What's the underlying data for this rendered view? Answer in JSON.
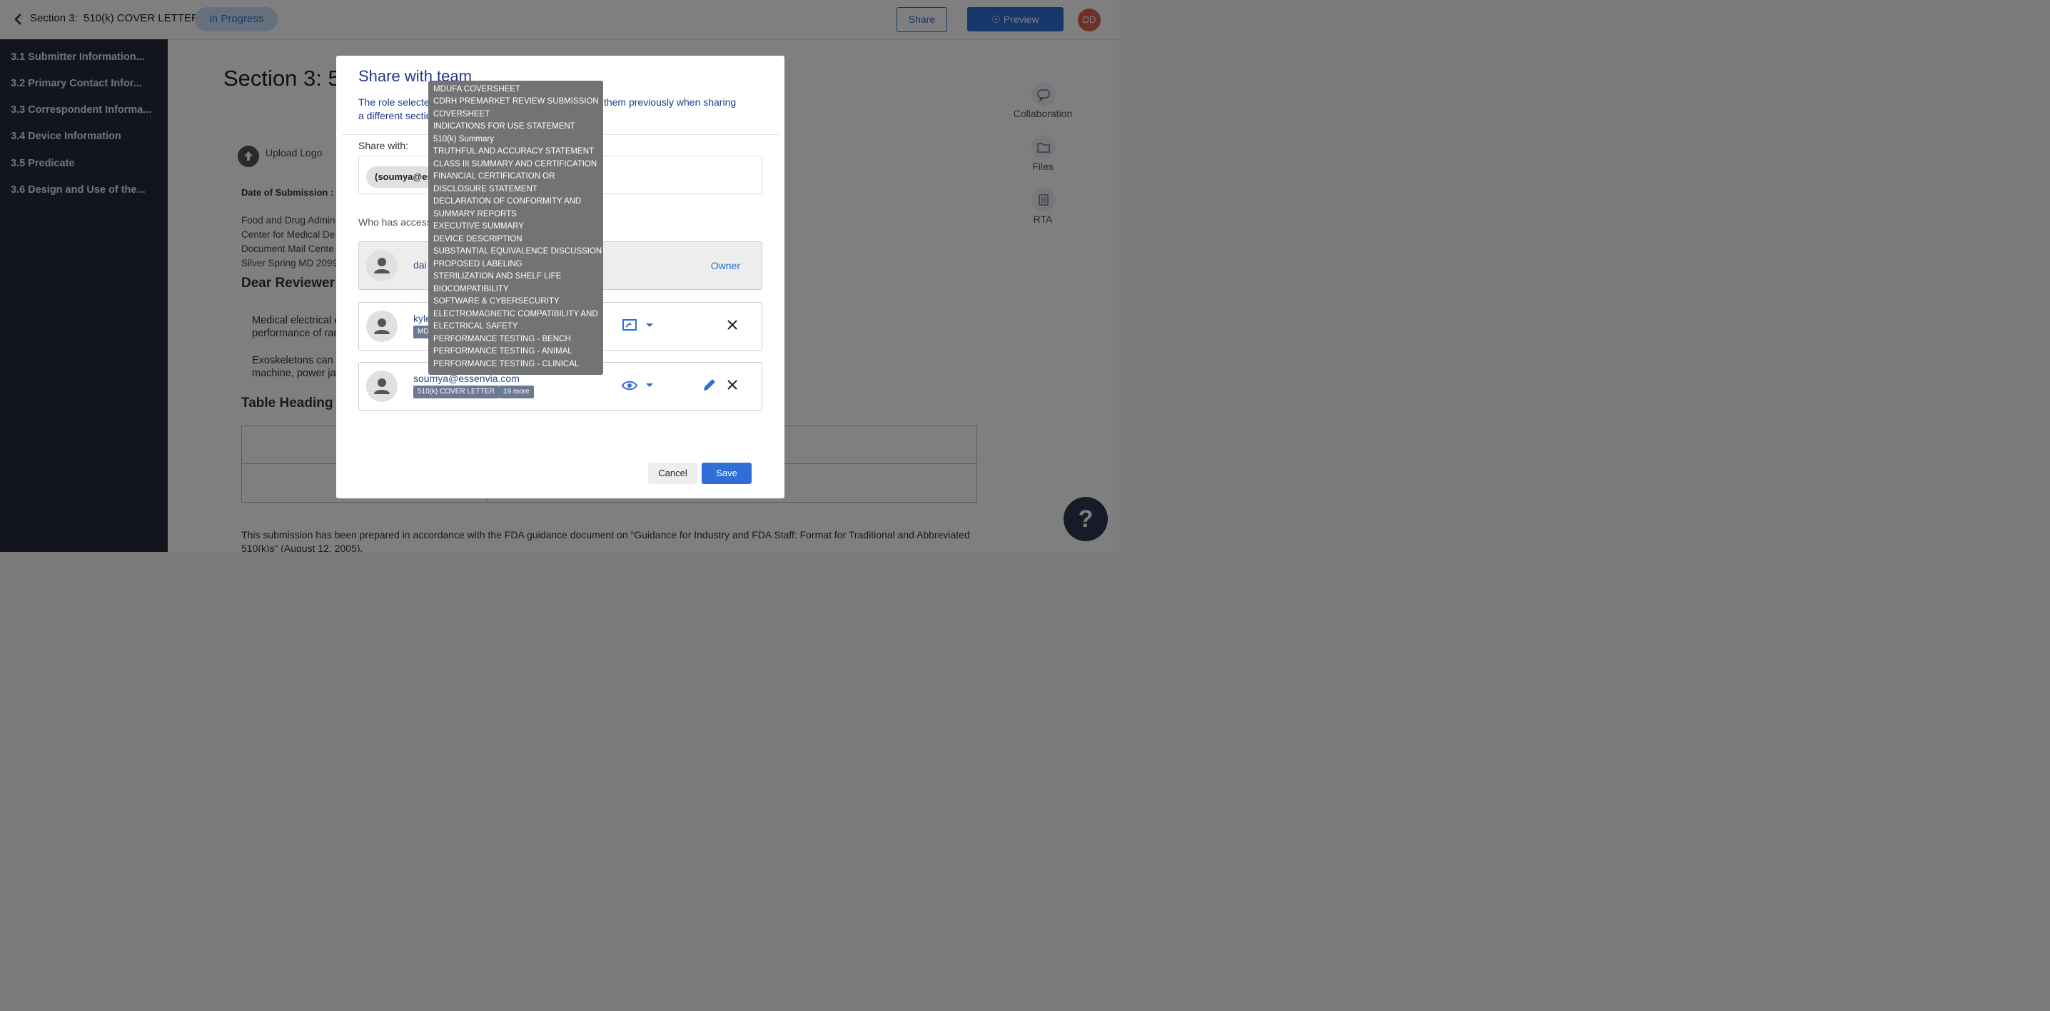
{
  "topbar": {
    "section_title": "Section 3:  510(k) COVER LETTER",
    "status": "In Progress",
    "share_label": "Share",
    "preview_label": "Preview",
    "avatar_initials": "DD"
  },
  "sidebar": {
    "items": [
      {
        "label": "3.1 Submitter Information..."
      },
      {
        "label": "3.2 Primary Contact Infor..."
      },
      {
        "label": "3.3 Correspondent Informa..."
      },
      {
        "label": "3.4 Device Information"
      },
      {
        "label": "3.5 Predicate"
      },
      {
        "label": "3.6 Design and Use of the..."
      }
    ]
  },
  "document": {
    "title": "Section 3: 5",
    "upload_logo": "Upload Logo",
    "date_label": "Date of Submission :",
    "address_lines": [
      "Food and Drug Admin",
      "Center for Medical De",
      "Document Mail Cente",
      "Silver Spring MD 2099"
    ],
    "dear": "Dear Reviewer",
    "para1_line1": "Medical electrical e",
    "para1_line2": "performance of radi",
    "para2_line1": "Exoskeletons can a",
    "para2_line2": "machine, power jac",
    "table_heading": "Table Heading H",
    "footer": "This submission has been prepared in accordance with the FDA guidance document on “Guidance for Industry and FDA Staff: Format for Traditional and Abbreviated 510(k)s” (August 12, 2005)."
  },
  "rail": {
    "collaboration": "Collaboration",
    "files": "Files",
    "rta": "RTA"
  },
  "help": {
    "label": "?"
  },
  "modal": {
    "title": "Share with team",
    "description": "The role selected will override the existing role given to them previously when sharing a different section.",
    "desc_visible_1": "The role selected",
    "desc_visible_1b": "n given to them previously when",
    "desc_visible_2": "sharing a differe",
    "share_with_label": "Share with:",
    "chip": "(soumya@essenvia.com",
    "chip_visible": "(soumya@ess",
    "who_has_access": "Who has access",
    "owner_email": "dai",
    "owner_label": "Owner",
    "user2_email": "kyle",
    "user2_tag": "MD",
    "user3_email": "soumya@essenvia.com",
    "user3_tag1": "510(k) COVER LETTER",
    "user3_tag2": "19 more",
    "cancel_label": "Cancel",
    "save_label": "Save"
  },
  "tooltip": {
    "items": [
      "MDUFA COVERSHEET",
      "CDRH PREMARKET REVIEW SUBMISSION",
      "COVERSHEET",
      "INDICATIONS FOR USE STATEMENT",
      "510(k) Summary",
      "TRUTHFUL AND ACCURACY STATEMENT",
      "CLASS III SUMMARY AND CERTIFICATION",
      "FINANCIAL CERTIFICATION OR",
      "DISCLOSURE STATEMENT",
      "DECLARATION OF CONFORMITY AND",
      "SUMMARY REPORTS",
      "EXECUTIVE SUMMARY",
      "DEVICE DESCRIPTION",
      "SUBSTANTIAL EQUIVALENCE DISCUSSION",
      "PROPOSED LABELING",
      "STERILIZATION AND SHELF LIFE",
      "BIOCOMPATIBILITY",
      "SOFTWARE & CYBERSECURITY",
      "ELECTROMAGNETIC COMPATIBILITY AND",
      "ELECTRICAL SAFETY",
      "PERFORMANCE TESTING - BENCH",
      "PERFORMANCE TESTING - ANIMAL",
      "PERFORMANCE TESTING - CLINICAL"
    ]
  },
  "colors": {
    "accent": "#2f6ed6",
    "sidebar_bg": "#24293d",
    "status_pill_bg": "#cfe3fb",
    "tooltip_bg": "#6e6e6e"
  }
}
